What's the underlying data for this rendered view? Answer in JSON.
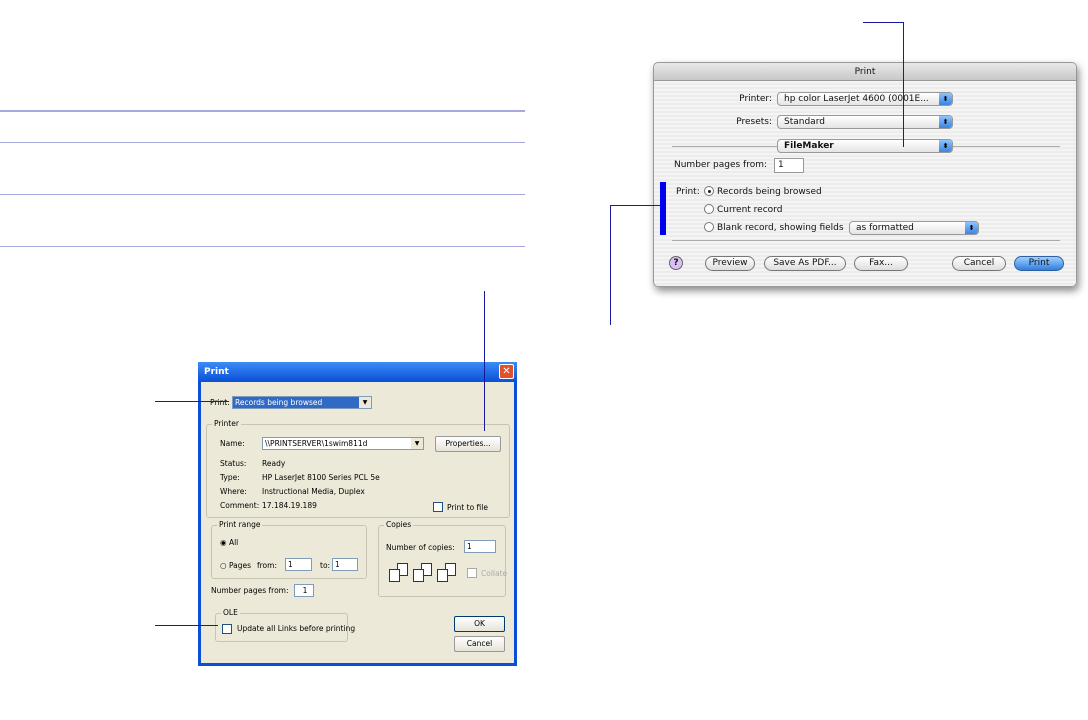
{
  "mac_dialog": {
    "title": "Print",
    "printer_label": "Printer:",
    "printer_value": "hp color LaserJet 4600 (0001E...",
    "presets_label": "Presets:",
    "presets_value": "Standard",
    "panel_value": "FileMaker",
    "number_pages_label": "Number pages from:",
    "number_pages_value": "1",
    "print_label": "Print:",
    "options": [
      "Records being browsed",
      "Current record",
      "Blank record, showing fields"
    ],
    "selected_option": 0,
    "blank_format_value": "as formatted",
    "buttons": {
      "help": "?",
      "preview": "Preview",
      "save_pdf": "Save As PDF...",
      "fax": "Fax...",
      "cancel": "Cancel",
      "print": "Print"
    }
  },
  "win_dialog": {
    "title": "Print",
    "close": "✕",
    "print_label": "Print:",
    "print_value": "Records being browsed",
    "printer_group": "Printer",
    "name_label": "Name:",
    "name_value": "\\\\PRINTSERVER\\1swim811d",
    "properties": "Properties...",
    "status_label": "Status:",
    "status_value": "Ready",
    "type_label": "Type:",
    "type_value": "HP LaserJet 8100 Series PCL 5e",
    "where_label": "Where:",
    "where_value": "Instructional Media, Duplex",
    "comment_label": "Comment:",
    "comment_value": "17.184.19.189",
    "print_to_file": "Print to file",
    "range_group": "Print range",
    "all": "All",
    "pages": "Pages",
    "from_label": "from:",
    "from_value": "1",
    "to_label": "to:",
    "to_value": "1",
    "copies_group": "Copies",
    "copies_label": "Number of copies:",
    "copies_value": "1",
    "collate": "Collate",
    "number_pages_label": "Number pages from:",
    "number_pages_value": "1",
    "ole_group": "OLE",
    "ole_checkbox": "Update all Links before printing",
    "ok": "OK",
    "cancel": "Cancel"
  }
}
